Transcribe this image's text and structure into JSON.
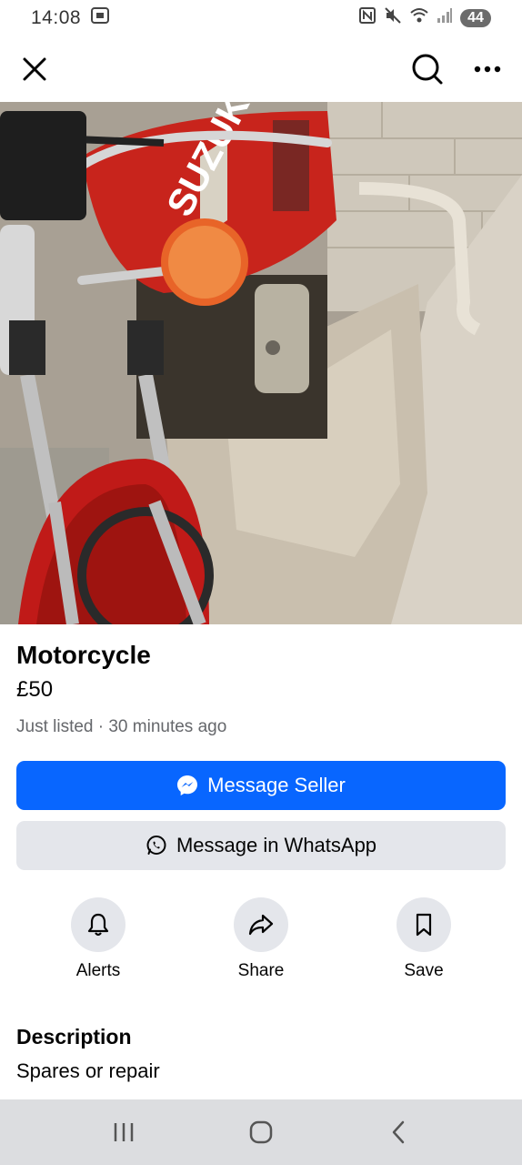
{
  "status_bar": {
    "time": "14:08",
    "battery": "44"
  },
  "header": {
    "close_icon": "close-icon",
    "search_icon": "search-icon",
    "more_icon": "more-horizontal-icon"
  },
  "photo": {
    "brand_text": "SUZUKI",
    "dots": 4,
    "active_dot": 0
  },
  "listing": {
    "title": "Motorcycle",
    "price": "£50",
    "meta": "Just listed · 30 minutes ago"
  },
  "buttons": {
    "message_seller": "Message Seller",
    "message_whatsapp": "Message in WhatsApp"
  },
  "actions": [
    {
      "label": "Alerts",
      "icon": "bell-icon"
    },
    {
      "label": "Share",
      "icon": "share-arrow-icon"
    },
    {
      "label": "Save",
      "icon": "bookmark-icon"
    }
  ],
  "description": {
    "heading": "Description",
    "text": "Spares or repair"
  },
  "colors": {
    "primary": "#0866ff",
    "secondary_bg": "#e4e6eb",
    "muted_text": "#65676b"
  }
}
